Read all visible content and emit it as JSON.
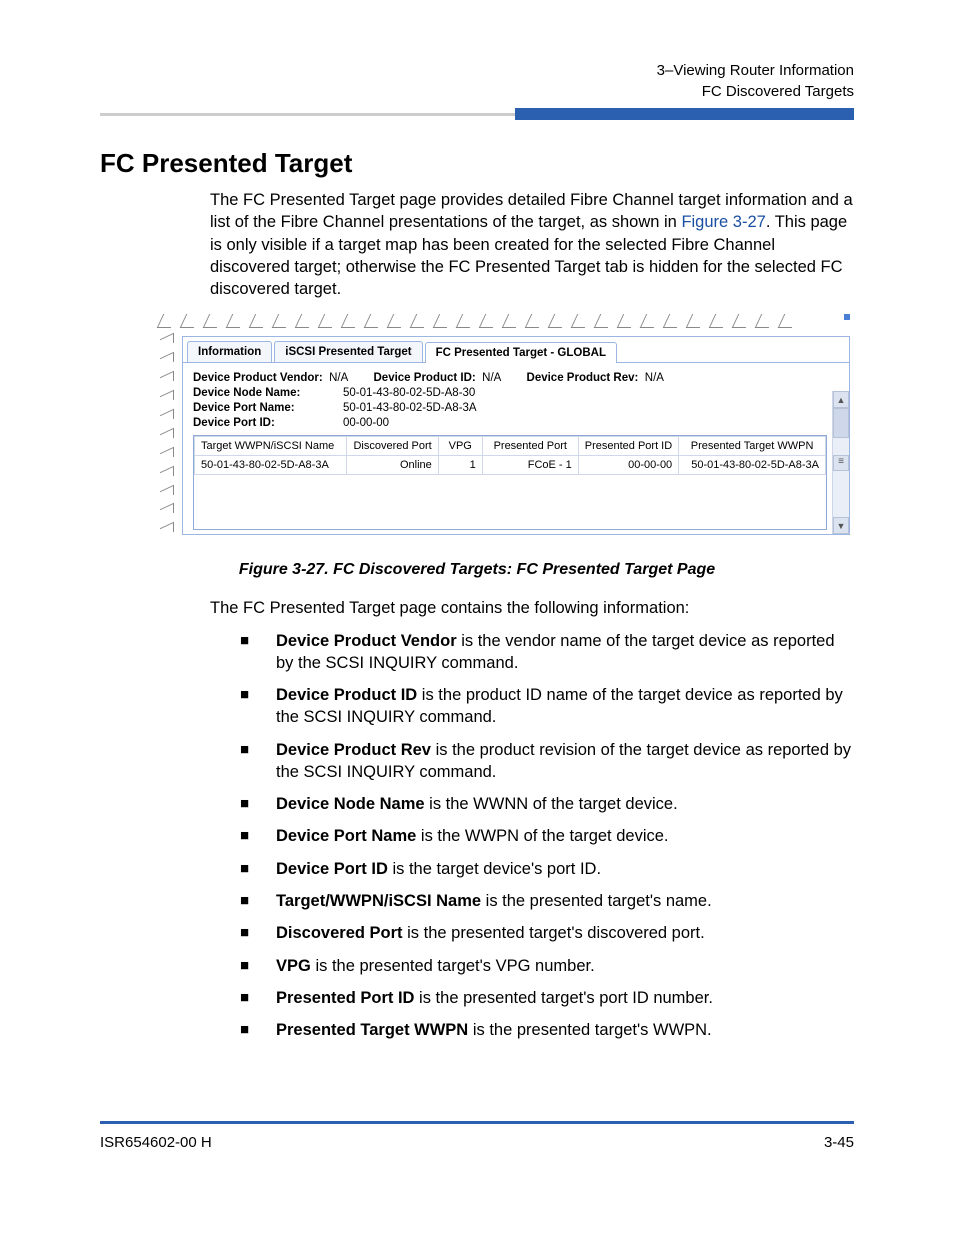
{
  "header": {
    "line1": "3–Viewing Router Information",
    "line2": "FC Discovered Targets"
  },
  "section_title": "FC Presented Target",
  "intro_pre": "The FC Presented Target page provides detailed Fibre Channel target information and a list of the Fibre Channel presentations of the target, as shown in ",
  "intro_link": "Figure 3-27",
  "intro_post": ". This page is only visible if a target map has been created for the selected Fibre Channel discovered target; otherwise the FC Presented Target tab is hidden for the selected FC discovered target.",
  "tabs": {
    "info": "Information",
    "iscsi": "iSCSI Presented Target",
    "fc": "FC Presented Target - GLOBAL"
  },
  "info": {
    "vendor_lbl": "Device Product Vendor:",
    "vendor_val": "N/A",
    "pid_lbl": "Device Product ID:",
    "pid_val": "N/A",
    "rev_lbl": "Device Product Rev:",
    "rev_val": "N/A",
    "node_lbl": "Device Node Name:",
    "node_val": "50-01-43-80-02-5D-A8-30",
    "port_lbl": "Device Port Name:",
    "port_val": "50-01-43-80-02-5D-A8-3A",
    "portid_lbl": "Device Port ID:",
    "portid_val": "00-00-00"
  },
  "grid": {
    "cols": {
      "c1": "Target WWPN/iSCSI Name",
      "c2": "Discovered Port",
      "c3": "VPG",
      "c4": "Presented Port",
      "c5": "Presented Port ID",
      "c6": "Presented Target WWPN"
    },
    "row": {
      "c1": "50-01-43-80-02-5D-A8-3A",
      "c2": "Online",
      "c3": "1",
      "c4": "FCoE - 1",
      "c5": "00-00-00",
      "c6": "50-01-43-80-02-5D-A8-3A"
    }
  },
  "figure_caption": "Figure 3-27. FC Discovered Targets: FC Presented Target Page",
  "after_fig": "The FC Presented Target page contains the following information:",
  "bullets": [
    {
      "b": "Device Product Vendor",
      "t": " is the vendor name of the target device as reported by the SCSI INQUIRY command."
    },
    {
      "b": "Device Product ID",
      "t": " is the product ID name of the target device as reported by the SCSI INQUIRY command."
    },
    {
      "b": "Device Product Rev",
      "t": " is the product revision of the target device as reported by the SCSI INQUIRY command."
    },
    {
      "b": "Device Node Name",
      "t": " is the WWNN of the target device."
    },
    {
      "b": "Device Port Name",
      "t": " is the WWPN of the target device."
    },
    {
      "b": "Device Port ID",
      "t": " is the target device's port ID."
    },
    {
      "b": "Target/WWPN/iSCSI Name",
      "t": " is the presented target's name."
    },
    {
      "b": "Discovered Port",
      "t": " is the presented target's discovered port."
    },
    {
      "b": "VPG",
      "t": " is the presented target's VPG number."
    },
    {
      "b": "Presented Port ID",
      "t": " is the presented target's port ID number."
    },
    {
      "b": "Presented Target WWPN",
      "t": " is the presented target's WWPN."
    }
  ],
  "footer": {
    "left": "ISR654602-00  H",
    "right": "3-45"
  }
}
